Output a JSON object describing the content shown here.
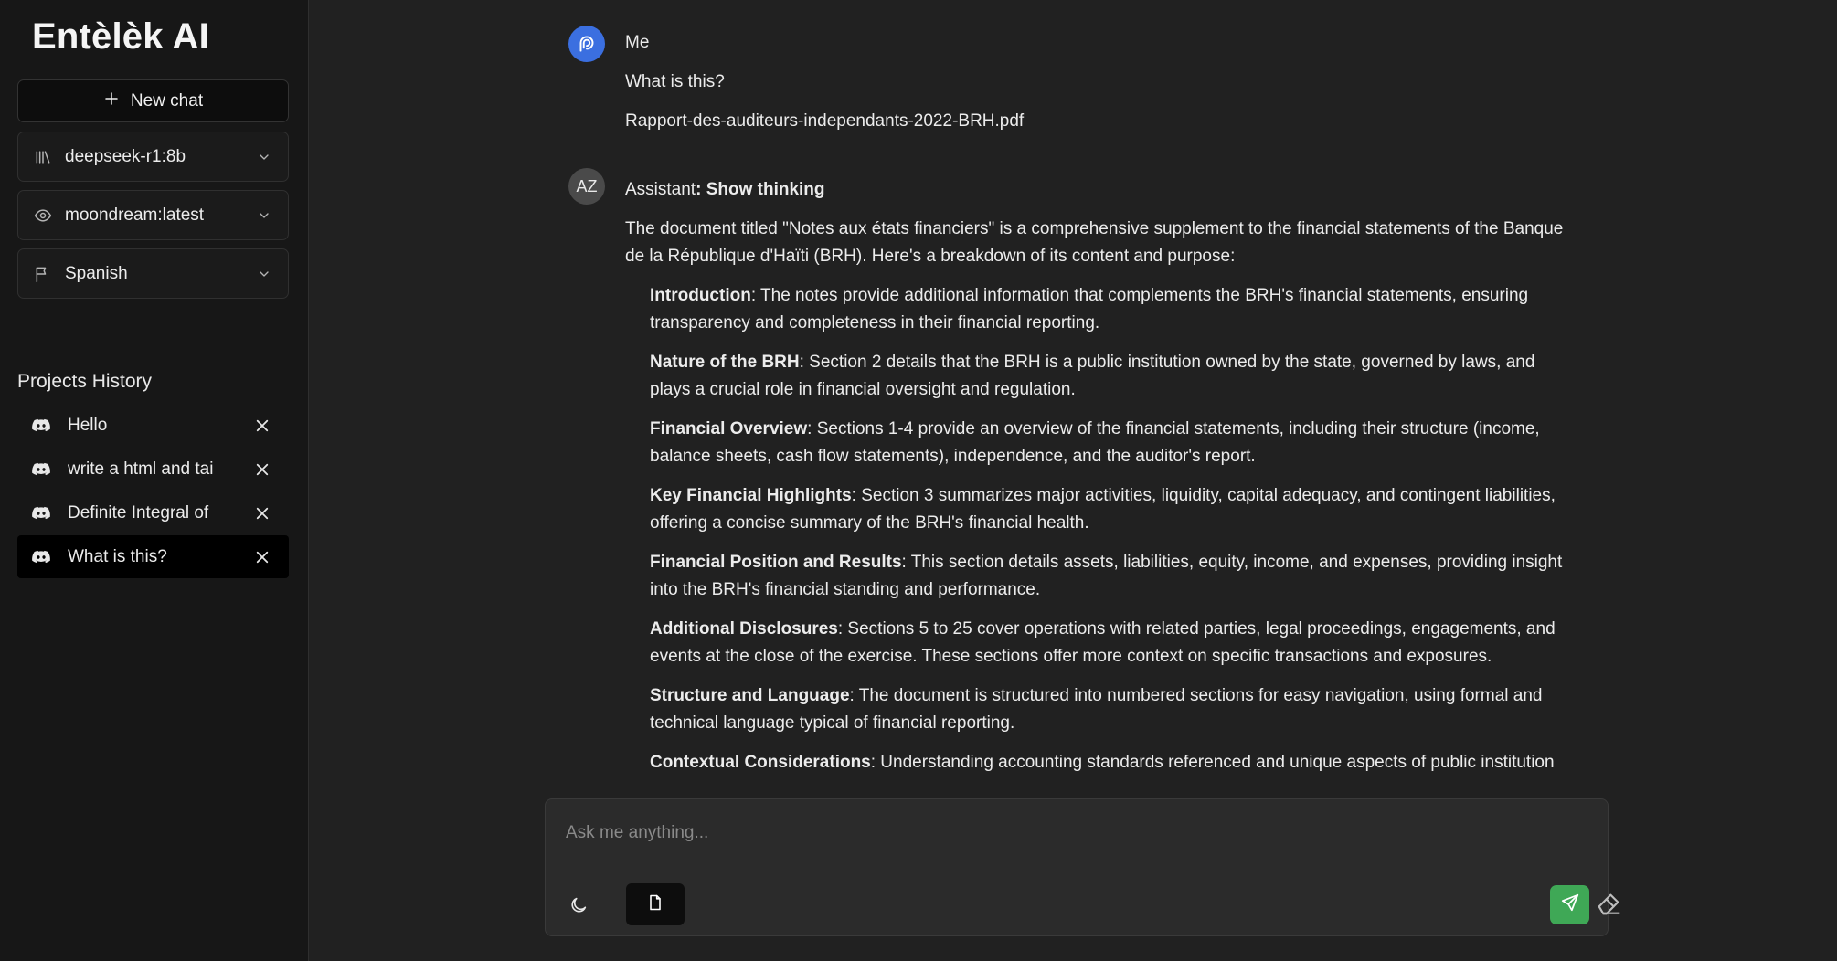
{
  "app": {
    "title": "Entèlèk AI"
  },
  "sidebar": {
    "new_chat_label": "New chat",
    "selects": [
      {
        "label": "deepseek-r1:8b",
        "icon": "library-icon"
      },
      {
        "label": "moondream:latest",
        "icon": "eye-icon"
      },
      {
        "label": "Spanish",
        "icon": "flag-icon"
      }
    ],
    "history_title": "Projects History",
    "history": [
      {
        "label": "Hello",
        "active": false
      },
      {
        "label": "write a html and tai",
        "active": false
      },
      {
        "label": "Definite Integral of",
        "active": false
      },
      {
        "label": "What is this?",
        "active": true
      }
    ]
  },
  "chat": {
    "user": {
      "name": "Me",
      "message": "What is this?",
      "attachment": "Rapport-des-auditeurs-independants-2022-BRH.pdf"
    },
    "assistant": {
      "initials": "AZ",
      "name": "Assistant",
      "show_thinking": ": Show thinking",
      "intro": "The document titled \"Notes aux états financiers\" is a comprehensive supplement to the financial statements of the Banque de la République d'Haïti (BRH). Here's a breakdown of its content and purpose:",
      "points": [
        {
          "title": "Introduction",
          "text": ": The notes provide additional information that complements the BRH's financial statements, ensuring transparency and completeness in their financial reporting."
        },
        {
          "title": "Nature of the BRH",
          "text": ": Section 2 details that the BRH is a public institution owned by the state, governed by laws, and plays a crucial role in financial oversight and regulation."
        },
        {
          "title": "Financial Overview",
          "text": ": Sections 1-4 provide an overview of the financial statements, including their structure (income, balance sheets, cash flow statements), independence, and the auditor's report."
        },
        {
          "title": "Key Financial Highlights",
          "text": ": Section 3 summarizes major activities, liquidity, capital adequacy, and contingent liabilities, offering a concise summary of the BRH's financial health."
        },
        {
          "title": "Financial Position and Results",
          "text": ": This section details assets, liabilities, equity, income, and expenses, providing insight into the BRH's financial standing and performance."
        },
        {
          "title": "Additional Disclosures",
          "text": ": Sections 5 to 25 cover operations with related parties, legal proceedings, engagements, and events at the close of the exercise. These sections offer more context on specific transactions and exposures."
        },
        {
          "title": "Structure and Language",
          "text": ": The document is structured into numbered sections for easy navigation, using formal and technical language typical of financial reporting."
        },
        {
          "title": "Contextual Considerations",
          "text": ": Understanding accounting standards referenced and unique aspects of public institution"
        }
      ]
    }
  },
  "composer": {
    "placeholder": "Ask me anything..."
  },
  "colors": {
    "send_button": "#3fa856",
    "user_avatar": "#3b6fe0",
    "sidebar_bg": "#171717",
    "main_bg": "#212121"
  }
}
